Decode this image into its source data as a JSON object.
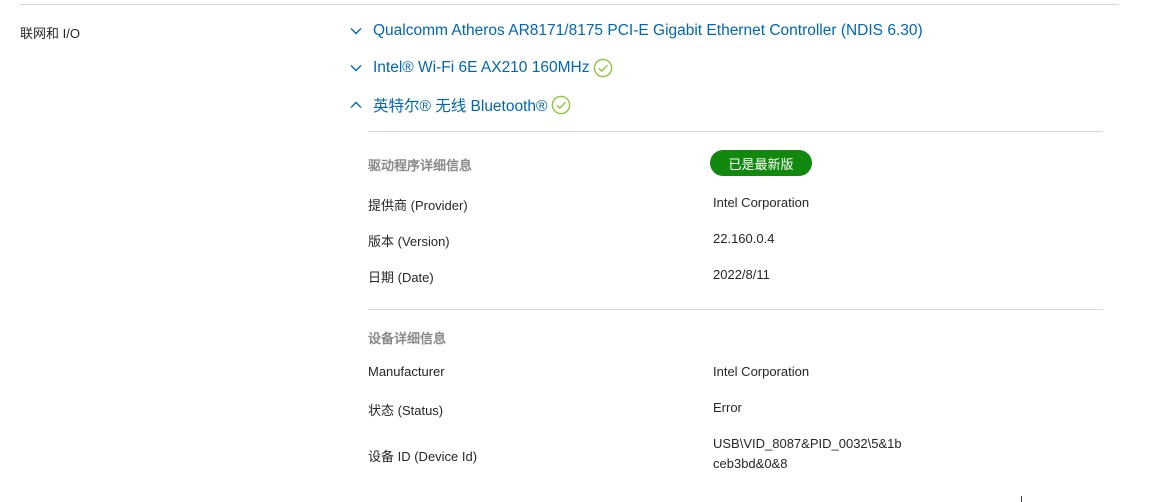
{
  "section": {
    "label": "联网和 I/O"
  },
  "devices": [
    {
      "name": "Qualcomm Atheros AR8171/8175 PCI-E Gigabit Ethernet Controller (NDIS 6.30)",
      "expanded": false,
      "status_icon": "none"
    },
    {
      "name": "Intel® Wi-Fi 6E AX210 160MHz",
      "expanded": false,
      "status_icon": "check-circle-icon"
    },
    {
      "name": "英特尔® 无线 Bluetooth®",
      "expanded": true,
      "status_icon": "check-circle-icon"
    }
  ],
  "driver_details": {
    "heading": "驱动程序详细信息",
    "badge": "已是最新版",
    "rows": [
      {
        "label": "提供商 (Provider)",
        "value": "Intel Corporation"
      },
      {
        "label": "版本 (Version)",
        "value": "22.160.0.4"
      },
      {
        "label": "日期 (Date)",
        "value": "2022/8/11"
      }
    ]
  },
  "device_details": {
    "heading": "设备详细信息",
    "rows": [
      {
        "label": "Manufacturer",
        "value": "Intel Corporation"
      },
      {
        "label": "状态 (Status)",
        "value": "Error"
      },
      {
        "label": "设备 ID (Device Id)",
        "value_line1": "USB\\VID_8087&PID_0032\\5&1b",
        "value_line2": "ceb3bd&0&8"
      }
    ]
  },
  "colors": {
    "link": "#0067b4",
    "badge_bg": "#12880e",
    "check": "#8cc63f",
    "muted_heading": "#8a8a8a",
    "rule": "#d8d8d8"
  }
}
